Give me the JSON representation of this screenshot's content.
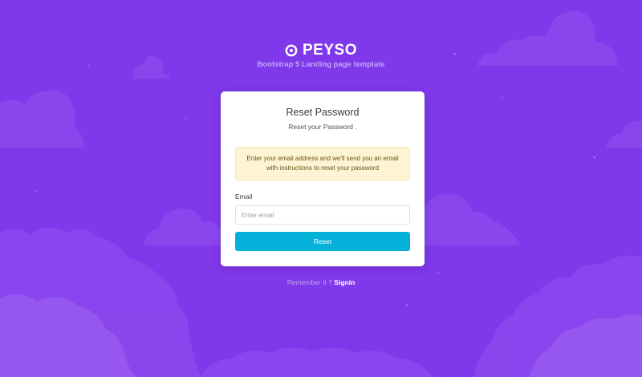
{
  "brand": {
    "name": "PEYSO",
    "tagline": "Bootstrap 5 Landing page template",
    "icon": "brand-logo-icon"
  },
  "card": {
    "title": "Reset Password",
    "subtitle": "Reset your Password .",
    "alert_lines": [
      "Enter your email address and we'll send you an email",
      "with instructions to reset your password"
    ],
    "email_label": "Email",
    "email_placeholder": "Enter email",
    "email_value": "",
    "reset_label": "Reset"
  },
  "footer": {
    "text": "Remember It ?",
    "link_label": "Signin"
  },
  "colors": {
    "background": "#7f38ea",
    "cloud": "#9352ef",
    "button": "#04b2d9",
    "alert_bg": "#fdf4d3",
    "alert_text": "#6b5319"
  }
}
